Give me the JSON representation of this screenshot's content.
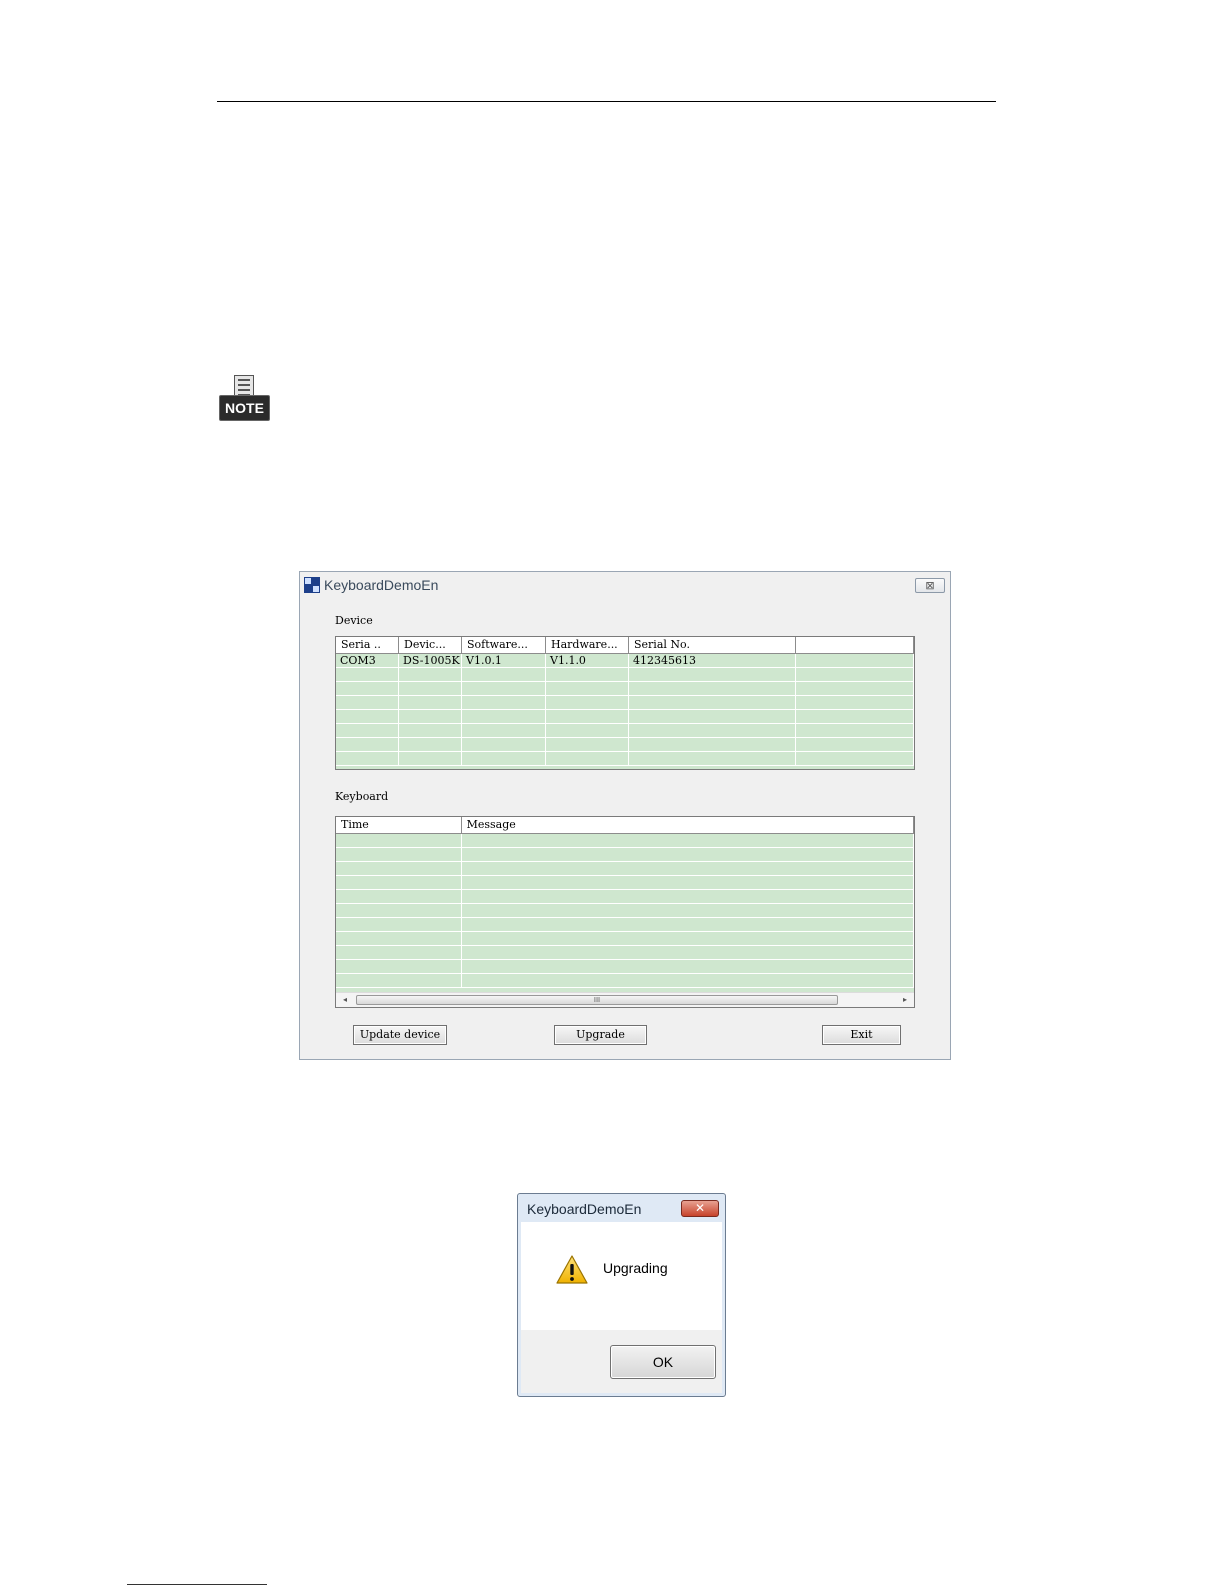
{
  "main_window": {
    "title": "KeyboardDemoEn",
    "close_glyph": "⊠",
    "device_group_label": "Device",
    "device_table": {
      "columns": [
        "Seria ..",
        "Devic...",
        "Software...",
        "Hardware...",
        "Serial No.",
        ""
      ],
      "rows": [
        [
          "COM3",
          "DS-1005K",
          "V1.0.1",
          "V1.1.0",
          "412345613",
          ""
        ],
        [
          "",
          "",
          "",
          "",
          "",
          ""
        ],
        [
          "",
          "",
          "",
          "",
          "",
          ""
        ],
        [
          "",
          "",
          "",
          "",
          "",
          ""
        ],
        [
          "",
          "",
          "",
          "",
          "",
          ""
        ],
        [
          "",
          "",
          "",
          "",
          "",
          ""
        ],
        [
          "",
          "",
          "",
          "",
          "",
          ""
        ],
        [
          "",
          "",
          "",
          "",
          "",
          ""
        ]
      ]
    },
    "keyboard_group_label": "Keyboard",
    "keyboard_table": {
      "columns": [
        "Time",
        "Message"
      ],
      "row_count": 11
    },
    "scrollbar": {
      "left_arrow": "◂",
      "right_arrow": "▸",
      "thumb_grip": "III"
    },
    "buttons": {
      "update_device": "Update device",
      "upgrade": "Upgrade",
      "exit": "Exit"
    }
  },
  "message_box": {
    "title": "KeyboardDemoEn",
    "close_glyph": "✕",
    "message": "Upgrading",
    "ok_label": "OK"
  },
  "note_badge": "NOTE"
}
